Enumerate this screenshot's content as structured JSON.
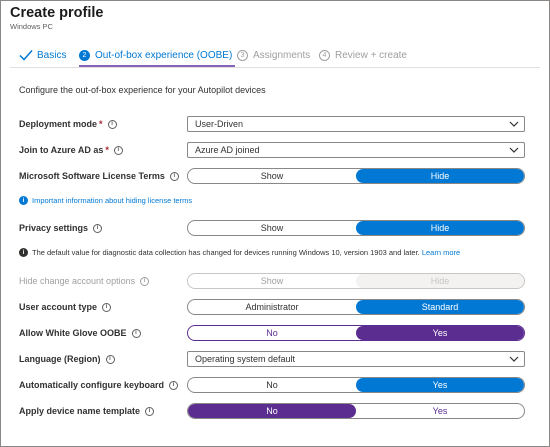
{
  "header": {
    "title": "Create profile",
    "subtitle": "Windows PC"
  },
  "tabs": [
    {
      "label": "Basics",
      "state": "done"
    },
    {
      "num": "2",
      "label": "Out-of-box experience (OOBE)",
      "state": "active"
    },
    {
      "num": "3",
      "label": "Assignments",
      "state": "inactive"
    },
    {
      "num": "4",
      "label": "Review + create",
      "state": "inactive"
    }
  ],
  "intro": "Configure the out-of-box experience for your Autopilot devices",
  "fields": {
    "deployment_mode": {
      "label": "Deployment mode",
      "required": "*",
      "value": "User-Driven"
    },
    "join_azure": {
      "label": "Join to Azure AD as",
      "required": "*",
      "value": "Azure AD joined"
    },
    "license_terms": {
      "label": "Microsoft Software License Terms",
      "options": [
        "Show",
        "Hide"
      ],
      "selected": "Hide"
    },
    "privacy": {
      "label": "Privacy settings",
      "options": [
        "Show",
        "Hide"
      ],
      "selected": "Hide"
    },
    "hide_change_account": {
      "label": "Hide change account options",
      "options": [
        "Show",
        "Hide"
      ],
      "selected": "Hide",
      "disabled": true
    },
    "user_account_type": {
      "label": "User account type",
      "options": [
        "Administrator",
        "Standard"
      ],
      "selected": "Standard"
    },
    "white_glove": {
      "label": "Allow White Glove OOBE",
      "options": [
        "No",
        "Yes"
      ],
      "selected": "Yes"
    },
    "language": {
      "label": "Language (Region)",
      "value": "Operating system default"
    },
    "keyboard": {
      "label": "Automatically configure keyboard",
      "options": [
        "No",
        "Yes"
      ],
      "selected": "Yes"
    },
    "device_name": {
      "label": "Apply device name template",
      "options": [
        "No",
        "Yes"
      ],
      "selected": "No"
    }
  },
  "notes": {
    "license_link": "Important information about hiding license terms",
    "privacy_text": "The default value for diagnostic data collection has changed for devices running Windows 10, version 1903 and later.",
    "privacy_link": "Learn more"
  },
  "info_glyph": "i",
  "colors": {
    "accent_blue": "#0078d4",
    "accent_purple": "#5c2d91",
    "required_red": "#a4262c"
  }
}
